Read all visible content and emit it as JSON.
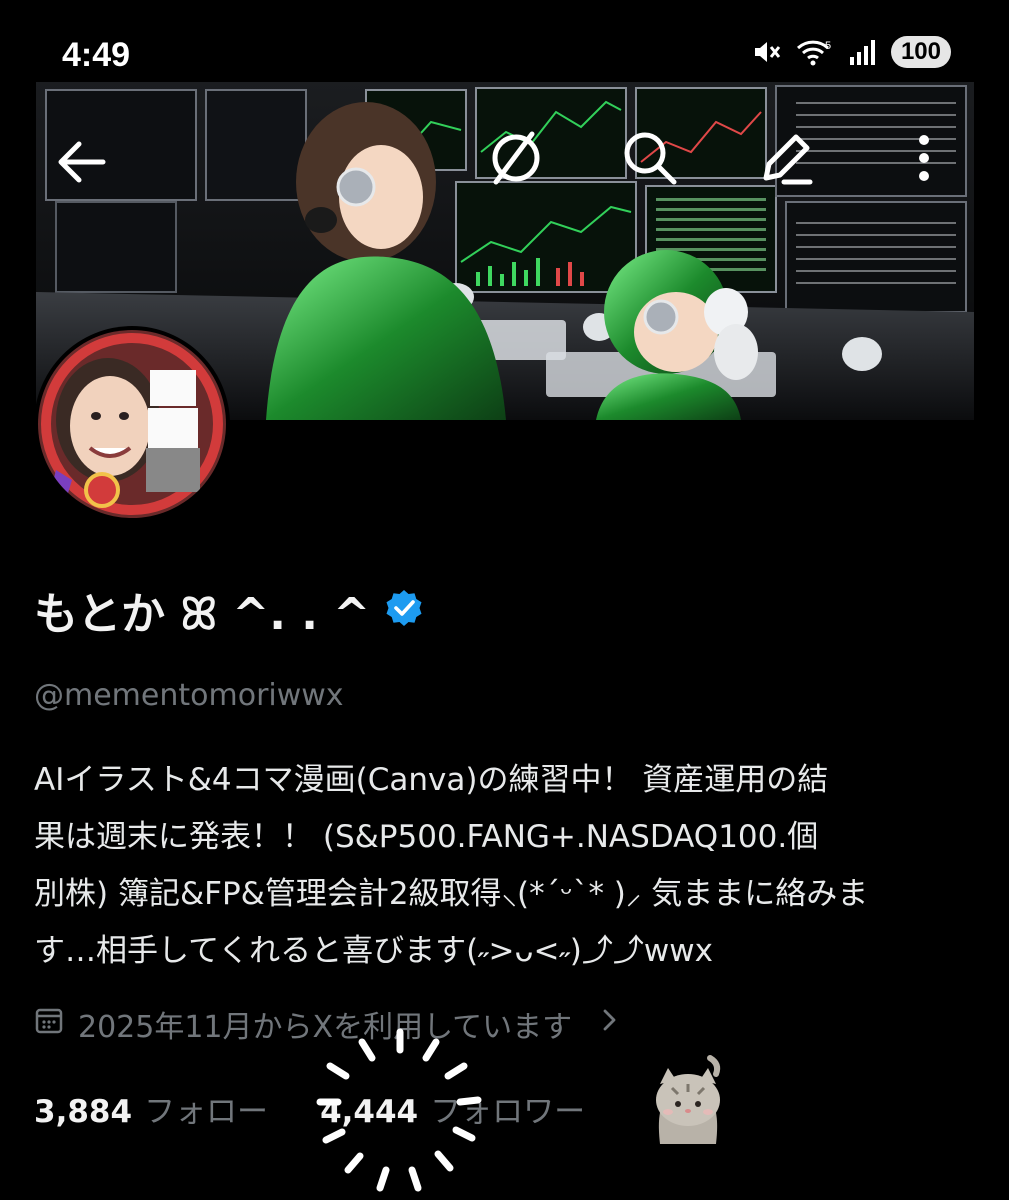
{
  "status_bar": {
    "time": "4:49",
    "battery": "100"
  },
  "header": {
    "back_icon": "arrow-left-icon",
    "grok_icon": "slashed-circle-icon",
    "search_icon": "search-icon",
    "compose_icon": "pencil-icon",
    "more_icon": "more-vertical-icon"
  },
  "profile": {
    "display_name": "もとか ꕤ ^. . ^",
    "verified": true,
    "handle": "@mementomoriwwx",
    "bio_lines": [
      "AIイラスト&4コマ漫画(Canva)の練習中！ 資産運用の結",
      "果は週末に発表！！ (S&P500.FANG+.NASDAQ100.個",
      "別株) 簿記&FP&管理会計2級取得⸜(*ˊᵕˋ* )⸝ 気ままに絡みま",
      "す…相手してくれると喜びます(˶>ᴗ<˶)⤴︎⤴︎wwx"
    ],
    "joined": "2025年11月からXを利用しています",
    "following_count": "3,884",
    "following_label": "フォロー",
    "followers_count": "4,444",
    "followers_label": "フォロワー"
  },
  "colors": {
    "verified": "#1d9bf0",
    "muted": "#71767b",
    "text": "#e7e9ea"
  }
}
